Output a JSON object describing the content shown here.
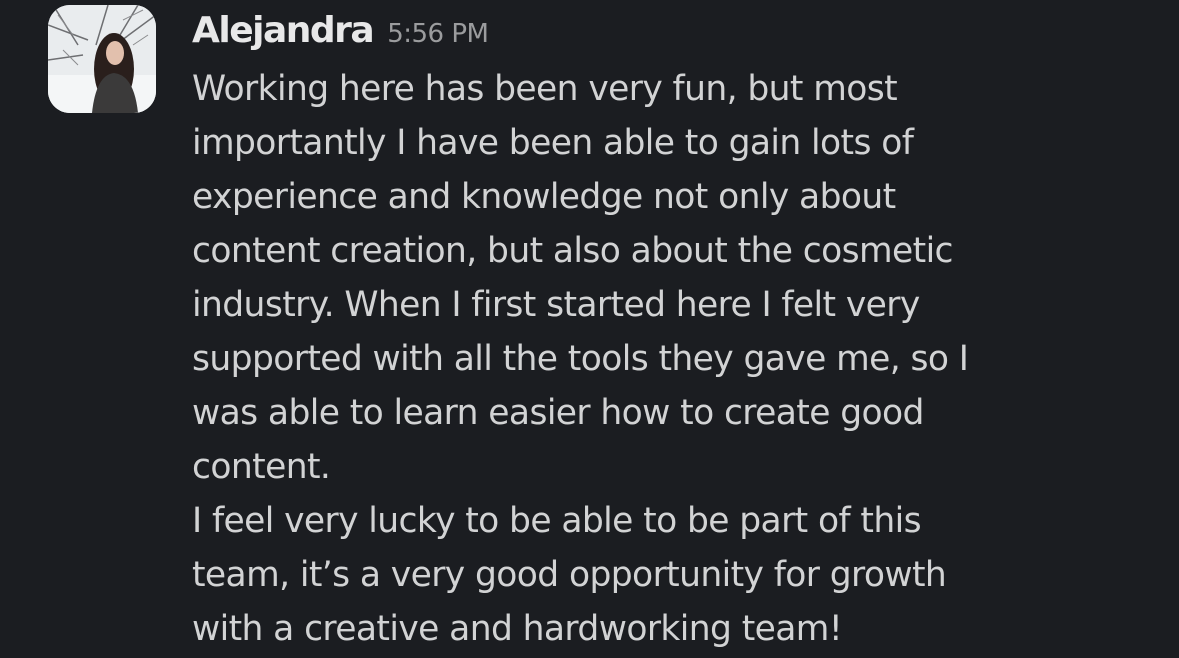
{
  "message": {
    "author": "Alejandra",
    "timestamp": "5:56 PM",
    "avatar_icon": "profile-photo-icon",
    "lines": [
      "Working here has been very fun, but most",
      "importantly I have been able to gain lots of",
      "experience and knowledge not only about",
      "content creation, but also about the cosmetic",
      "industry. When I first started here I felt very",
      "supported with all the tools they gave me, so I",
      "was able to learn easier how to create good",
      "content.",
      "I feel very lucky to be able to be part of this",
      "team, it’s a very good opportunity for growth",
      "with a creative and hardworking team!"
    ]
  },
  "colors": {
    "background": "#1b1d21",
    "author": "#e8e8e9",
    "timestamp": "#9b9c9e",
    "body_text": "#d2d3d4"
  }
}
